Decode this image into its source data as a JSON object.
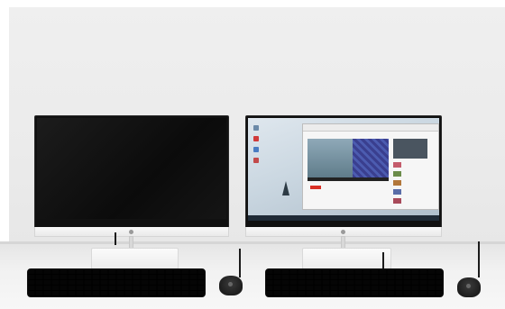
{
  "scene": {
    "description_items": [
      "left-monitor-off",
      "right-monitor-on",
      "two-keyboards",
      "two-mice"
    ],
    "colors": {
      "wall": "#ebebeb",
      "desk": "#f3f3f3",
      "bezel": "#111111",
      "stand": "#f2f2f2",
      "peripherals": "#1d1d1d"
    }
  },
  "right_screen": {
    "content": "desktop-with-browser-video",
    "icons": [
      "app-icon",
      "app-icon",
      "app-icon",
      "app-icon"
    ]
  }
}
